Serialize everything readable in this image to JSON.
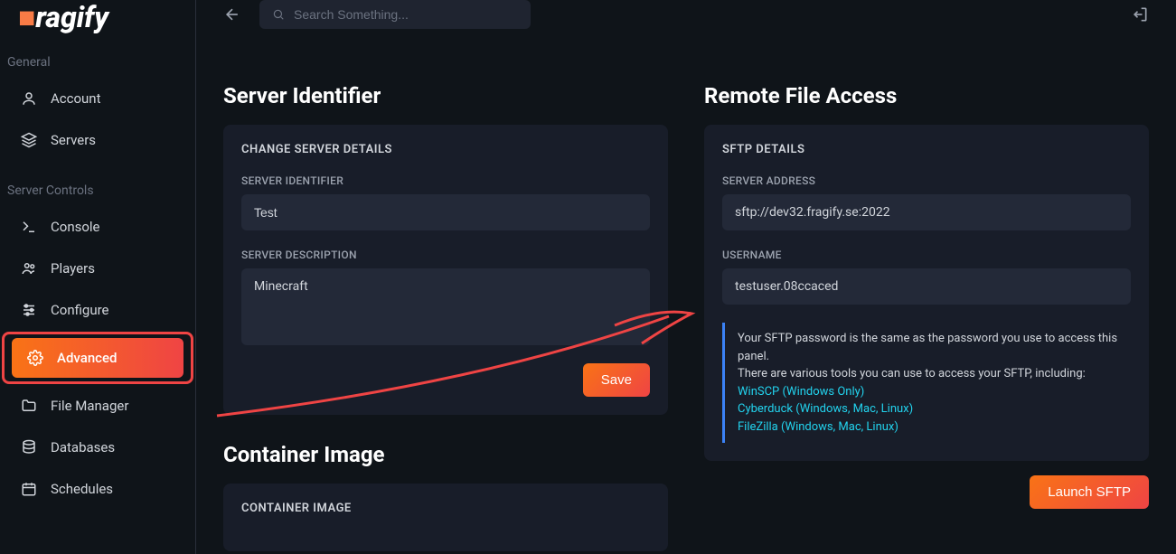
{
  "sidebar": {
    "sections": [
      {
        "label": "General",
        "items": [
          {
            "label": "Account",
            "icon": "user"
          },
          {
            "label": "Servers",
            "icon": "layers"
          }
        ]
      },
      {
        "label": "Server Controls",
        "items": [
          {
            "label": "Console",
            "icon": "terminal"
          },
          {
            "label": "Players",
            "icon": "users"
          },
          {
            "label": "Configure",
            "icon": "sliders"
          },
          {
            "label": "Advanced",
            "icon": "gear",
            "active": true
          },
          {
            "label": "File Manager",
            "icon": "folder"
          },
          {
            "label": "Databases",
            "icon": "database"
          },
          {
            "label": "Schedules",
            "icon": "calendar"
          }
        ]
      }
    ]
  },
  "topbar": {
    "search_placeholder": "Search Something..."
  },
  "server_identifier": {
    "title": "Server Identifier",
    "card_heading": "CHANGE SERVER DETAILS",
    "identifier_label": "SERVER IDENTIFIER",
    "identifier_value": "Test",
    "description_label": "SERVER DESCRIPTION",
    "description_value": "Minecraft",
    "save_label": "Save"
  },
  "container_image": {
    "title": "Container Image",
    "card_heading": "CONTAINER IMAGE"
  },
  "remote_access": {
    "title": "Remote File Access",
    "card_heading": "SFTP DETAILS",
    "address_label": "SERVER ADDRESS",
    "address_value": "sftp://dev32.fragify.se:2022",
    "username_label": "USERNAME",
    "username_value": "testuser.08ccaced",
    "info_line1": "Your SFTP password is the same as the password you use to access this panel.",
    "info_line2": "There are various tools you can use to access your SFTP, including:",
    "links": [
      "WinSCP (Windows Only)",
      "Cyberduck (Windows, Mac, Linux)",
      "FileZilla (Windows, Mac, Linux)"
    ],
    "launch_label": "Launch SFTP"
  }
}
